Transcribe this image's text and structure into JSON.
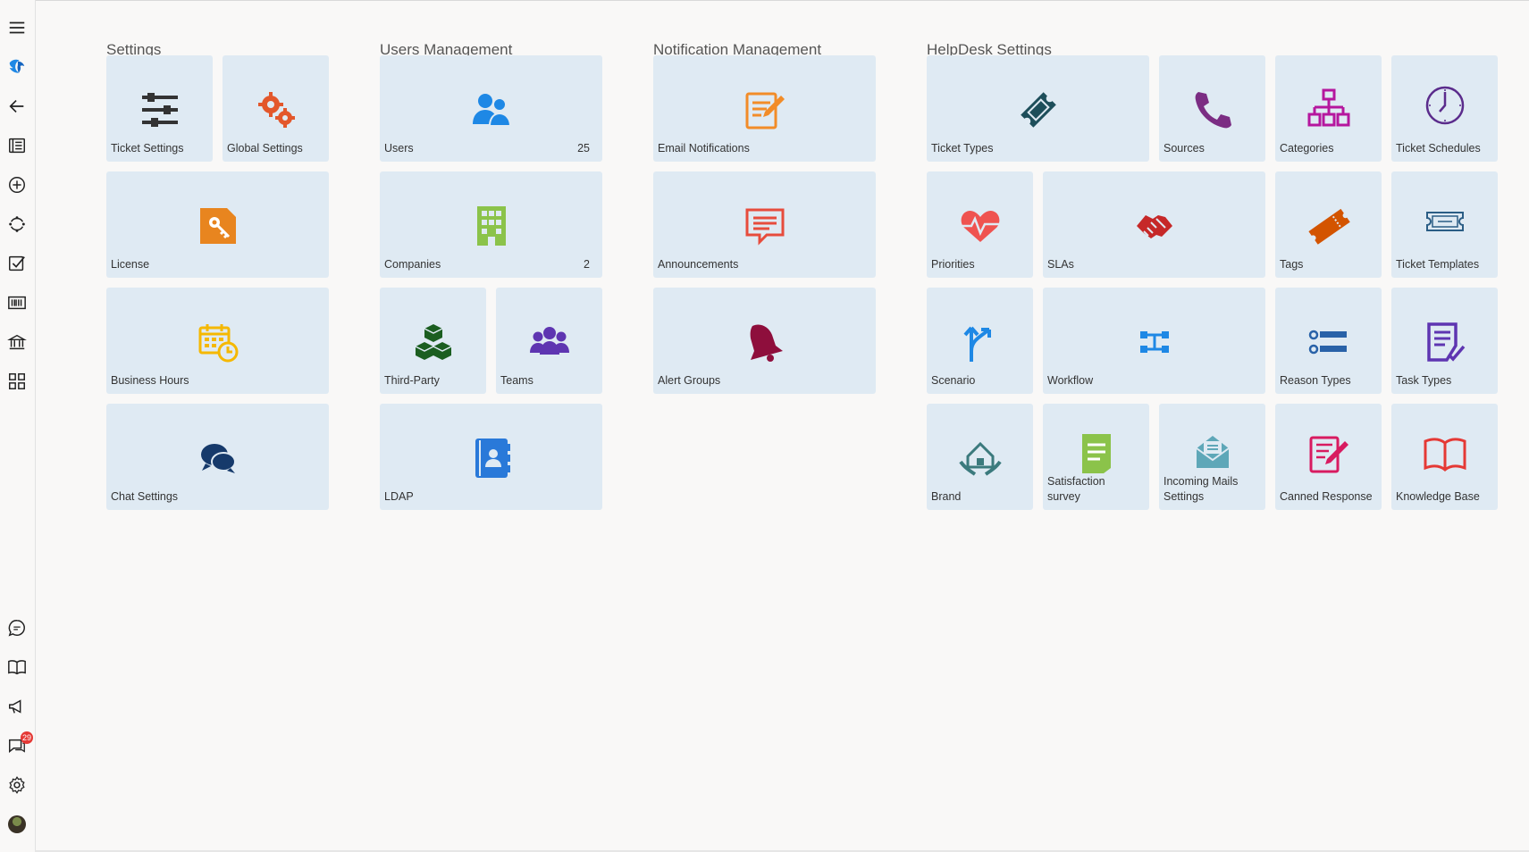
{
  "sidebar": {
    "items": [
      {
        "name": "menu-icon"
      },
      {
        "name": "logo-icon"
      },
      {
        "name": "back-arrow-icon"
      },
      {
        "name": "tickets-list-icon"
      },
      {
        "name": "add-circle-icon"
      },
      {
        "name": "sync-icon"
      },
      {
        "name": "tasks-checkbox-icon"
      },
      {
        "name": "barcode-icon"
      },
      {
        "name": "bank-icon"
      },
      {
        "name": "apps-grid-icon"
      },
      {
        "name": "chat-bubble-icon"
      },
      {
        "name": "book-icon"
      },
      {
        "name": "megaphone-icon"
      },
      {
        "name": "messages-icon"
      },
      {
        "name": "settings-gear-icon"
      },
      {
        "name": "user-avatar"
      }
    ],
    "messages_badge": "29"
  },
  "sections": {
    "settings": {
      "title": "Settings",
      "tiles": {
        "ticket_settings": {
          "label": "Ticket Settings"
        },
        "global_settings": {
          "label": "Global Settings"
        },
        "license": {
          "label": "License"
        },
        "business_hours": {
          "label": "Business Hours"
        },
        "chat_settings": {
          "label": "Chat Settings"
        }
      }
    },
    "users": {
      "title": "Users Management",
      "tiles": {
        "users": {
          "label": "Users",
          "count": "25"
        },
        "companies": {
          "label": "Companies",
          "count": "2"
        },
        "third_party": {
          "label": "Third-Party"
        },
        "teams": {
          "label": "Teams"
        },
        "ldap": {
          "label": "LDAP"
        }
      }
    },
    "notifications": {
      "title": "Notification Management",
      "tiles": {
        "email_notifications": {
          "label": "Email Notifications"
        },
        "announcements": {
          "label": "Announcements"
        },
        "alert_groups": {
          "label": "Alert Groups"
        }
      }
    },
    "helpdesk": {
      "title": "HelpDesk Settings",
      "tiles": {
        "ticket_types": {
          "label": "Ticket Types"
        },
        "sources": {
          "label": "Sources"
        },
        "categories": {
          "label": "Categories"
        },
        "ticket_schedules": {
          "label": "Ticket Schedules"
        },
        "priorities": {
          "label": "Priorities"
        },
        "slas": {
          "label": "SLAs"
        },
        "tags": {
          "label": "Tags"
        },
        "ticket_templates": {
          "label": "Ticket Templates"
        },
        "scenario": {
          "label": "Scenario"
        },
        "workflow": {
          "label": "Workflow"
        },
        "reason_types": {
          "label": "Reason Types"
        },
        "task_types": {
          "label": "Task Types"
        },
        "brand": {
          "label": "Brand"
        },
        "satisfaction_survey": {
          "label": "Satisfaction survey"
        },
        "incoming_mails": {
          "label": "Incoming Mails Settings"
        },
        "canned_response": {
          "label": "Canned Response"
        },
        "knowledge_base": {
          "label": "Knowledge Base"
        }
      }
    }
  },
  "colors": {
    "tile_bg": "#dfeaf3",
    "page_bg": "#f9f8f7",
    "badge": "#e53935"
  }
}
